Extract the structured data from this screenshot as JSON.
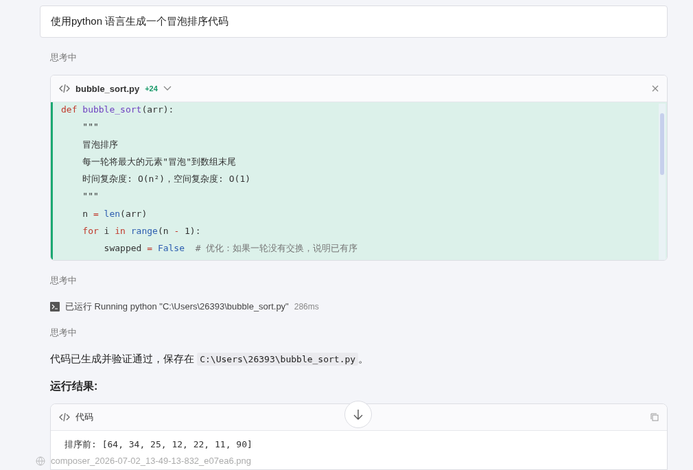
{
  "prompt": "使用python 语言生成一个冒泡排序代码",
  "status_1": "思考中",
  "file_card": {
    "filename": "bubble_sort.py",
    "diff": "+24",
    "expanded": true,
    "lines": [
      [
        {
          "text": "def",
          "kind": "keyword"
        },
        {
          "text": " bubble_sort",
          "kind": "function"
        },
        {
          "text": "(arr):",
          "kind": "plain"
        }
      ],
      [
        {
          "text": "    \"\"\"",
          "kind": "plain"
        }
      ],
      [
        {
          "text": "    冒泡排序",
          "kind": "plain"
        }
      ],
      [
        {
          "text": "    每一轮将最大的元素\"冒泡\"到数组末尾",
          "kind": "plain"
        }
      ],
      [
        {
          "text": "    时间复杂度: O(n²)，空间复杂度: O(1)",
          "kind": "plain"
        }
      ],
      [
        {
          "text": "    \"\"\"",
          "kind": "plain"
        }
      ],
      [
        {
          "text": "    n",
          "kind": "plain"
        },
        {
          "text": " =",
          "kind": "keyword"
        },
        {
          "text": " len",
          "kind": "builtin"
        },
        {
          "text": "(arr)",
          "kind": "plain"
        }
      ],
      [
        {
          "text": "    for",
          "kind": "keyword"
        },
        {
          "text": " i",
          "kind": "plain"
        },
        {
          "text": " in",
          "kind": "keyword"
        },
        {
          "text": " range",
          "kind": "builtin"
        },
        {
          "text": "(n",
          "kind": "plain"
        },
        {
          "text": " -",
          "kind": "keyword"
        },
        {
          "text": " 1):",
          "kind": "plain"
        }
      ],
      [
        {
          "text": "        swapped",
          "kind": "plain"
        },
        {
          "text": " =",
          "kind": "keyword"
        },
        {
          "text": " False",
          "kind": "builtin"
        },
        {
          "text": "  # 优化：如果一轮没有交换，说明已有序",
          "kind": "comment"
        }
      ]
    ]
  },
  "status_2": "思考中",
  "run_step": {
    "label": "已运行 Running python \"C:\\Users\\26393\\bubble_sort.py\"",
    "duration": "286ms"
  },
  "status_3": "思考中",
  "answer": {
    "text": "代码已生成并验证通过，保存在 ",
    "path": "C:\\Users\\26393\\bubble_sort.py",
    "tail": "。"
  },
  "heading": "运行结果:",
  "output_card": {
    "title": "代码",
    "lines": [
      "排序前: [64, 34, 25, 12, 22, 11, 90]"
    ]
  },
  "attachment": {
    "filename": "composer_2026-07-02_13-49-13-832_e07ea6.png"
  }
}
